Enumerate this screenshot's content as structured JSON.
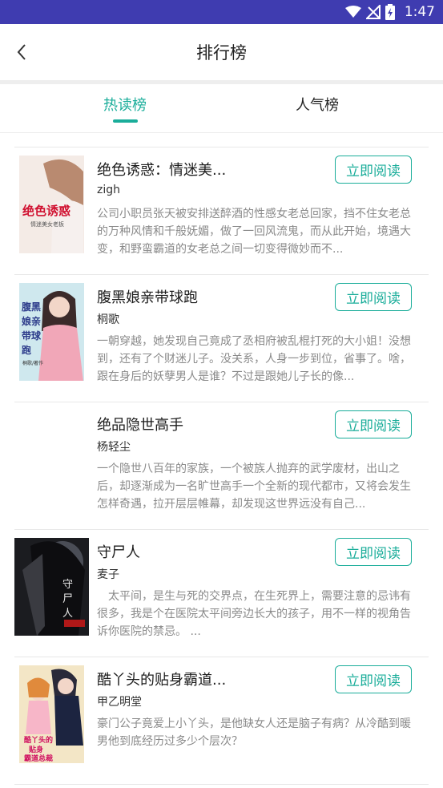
{
  "status_bar": {
    "time": "1:47",
    "icons": [
      "wifi-icon",
      "signal-off-icon",
      "battery-charging-icon"
    ]
  },
  "header": {
    "title": "排行榜",
    "back_icon": "chevron-left-icon"
  },
  "tabs": [
    {
      "label": "热读榜",
      "active": true
    },
    {
      "label": "人气榜",
      "active": false
    }
  ],
  "colors": {
    "accent": "#1aad9a",
    "status_bar": "#3f3cb0"
  },
  "books": [
    {
      "title": "绝色诱惑：情迷美...",
      "author": "zigh",
      "description": "公司小职员张天被安排送醉酒的性感女老总回家，挡不住女老总的万种风情和千般妩媚，做了一回风流鬼，而从此开始，境遇大变，和野蛮霸道的女老总之间一切变得微妙而不...",
      "button": "立即阅读",
      "cover_text": "绝色诱惑",
      "cover_subtitle": "情迷美女老板"
    },
    {
      "title": "腹黑娘亲带球跑",
      "author": "桐歌",
      "description": "一朝穿越，她发现自己竟成了丞相府被乱棍打死的大小姐！没想到，还有了个财迷儿子。没关系，人身一步到位，省事了。啥，跟在身后的妖孽男人是谁？不过是跟她儿子长的像...",
      "button": "立即阅读",
      "cover_text": "腹黑娘亲带球跑",
      "cover_subtitle": "桐歌/著作"
    },
    {
      "title": "绝品隐世高手",
      "author": "杨轻尘",
      "description": "一个隐世八百年的家族，一个被族人抛弃的武学废材，出山之后，却逐渐成为一名旷世高手一个全新的现代都市，又将会发生怎样奇遇，拉开层层帷幕，却发现这世界远没有自己...",
      "button": "立即阅读",
      "cover_text": "",
      "cover_subtitle": ""
    },
    {
      "title": "守尸人",
      "author": "麦子",
      "description": "　太平间，是生与死的交界点，在生死界上，需要注意的忌讳有很多，我是个在医院太平间旁边长大的孩子，用不一样的视角告诉你医院的禁忌。 ...",
      "button": "立即阅读",
      "cover_text": "守尸人",
      "cover_subtitle": "麦子"
    },
    {
      "title": "酷丫头的贴身霸道...",
      "author": "甲乙明堂",
      "description": "豪门公子竟爱上小丫头，是他缺女人还是脑子有病？从冷酷到暖男他到底经历过多少个层次？",
      "button": "立即阅读",
      "cover_text": "酷丫头的贴身霸道总裁",
      "cover_subtitle": ""
    }
  ]
}
